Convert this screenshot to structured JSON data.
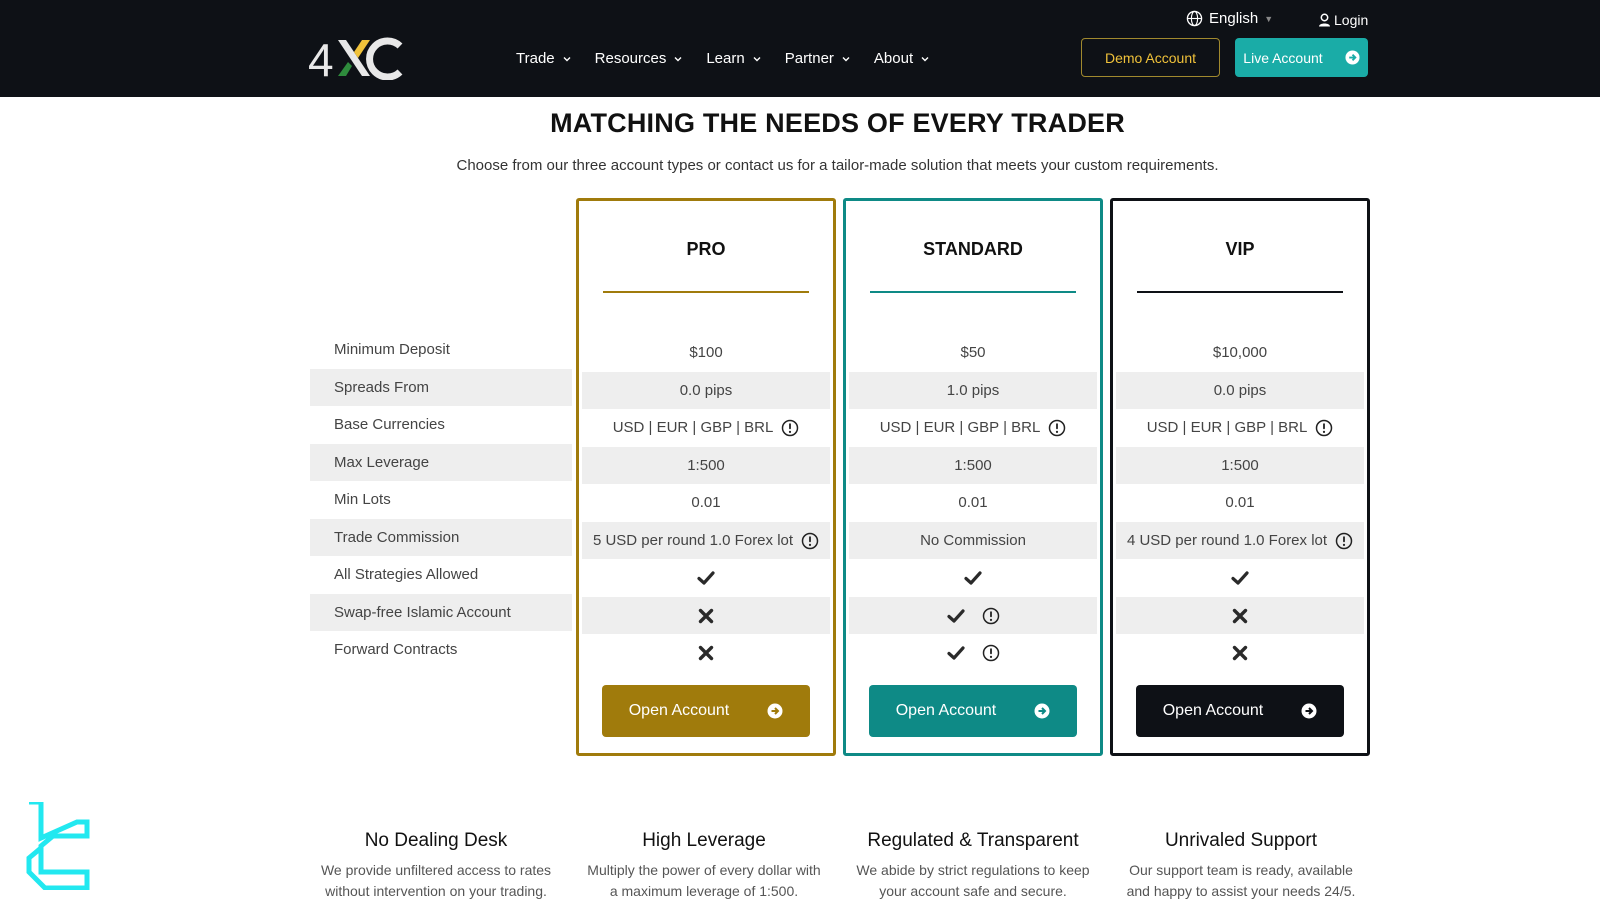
{
  "header": {
    "logo_text": "4XC",
    "nav": [
      {
        "label": "Trade"
      },
      {
        "label": "Resources"
      },
      {
        "label": "Learn"
      },
      {
        "label": "Partner"
      },
      {
        "label": "About"
      }
    ],
    "language": "English",
    "login": "Login",
    "demo_button": "Demo Account",
    "live_button": "Live Account"
  },
  "page": {
    "title": "MATCHING THE NEEDS OF EVERY TRADER",
    "subtitle": "Choose from our three account types or contact us for a tailor-made solution that meets your custom requirements."
  },
  "comparison": {
    "row_labels": [
      "Minimum Deposit",
      "Spreads From",
      "Base Currencies",
      "Max Leverage",
      "Min Lots",
      "Trade Commission",
      "All Strategies Allowed",
      "Swap-free Islamic Account",
      "Forward Contracts"
    ],
    "plans": [
      {
        "name": "PRO",
        "accent": "#a07b0c",
        "min_deposit": "$100",
        "spreads_from": "0.0 pips",
        "base_currencies": "USD | EUR | GBP | BRL",
        "max_leverage": "1:500",
        "min_lots": "0.01",
        "trade_commission": "5 USD per round 1.0 Forex lot",
        "all_strategies": "check",
        "swap_free": "cross",
        "forward_contracts": "cross",
        "button": "Open Account"
      },
      {
        "name": "STANDARD",
        "accent": "#0e8a86",
        "min_deposit": "$50",
        "spreads_from": "1.0 pips",
        "base_currencies": "USD | EUR | GBP | BRL",
        "max_leverage": "1:500",
        "min_lots": "0.01",
        "trade_commission": "No Commission",
        "all_strategies": "check",
        "swap_free": "check",
        "forward_contracts": "check",
        "button": "Open Account"
      },
      {
        "name": "VIP",
        "accent": "#0e1116",
        "min_deposit": "$10,000",
        "spreads_from": "0.0 pips",
        "base_currencies": "USD | EUR | GBP | BRL",
        "max_leverage": "1:500",
        "min_lots": "0.01",
        "trade_commission": "4 USD per round 1.0 Forex lot",
        "all_strategies": "check",
        "swap_free": "cross",
        "forward_contracts": "cross",
        "button": "Open Account"
      }
    ]
  },
  "features": [
    {
      "title": "No Dealing Desk",
      "text": "We provide unfiltered access to rates without intervention on your trading."
    },
    {
      "title": "High Leverage",
      "text": "Multiply the power of every dollar with a maximum leverage of 1:500."
    },
    {
      "title": "Regulated & Transparent",
      "text": "We abide by strict regulations to keep your account safe and secure."
    },
    {
      "title": "Unrivaled Support",
      "text": "Our support team is ready, available and happy to assist your needs 24/5."
    }
  ],
  "colors": {
    "header_bg": "#0e1116",
    "gold": "#a07b0c",
    "teal": "#0e8a86",
    "live_teal": "#1aaca7",
    "demo_text": "#f0c23a",
    "watermark": "#22e8f0"
  }
}
